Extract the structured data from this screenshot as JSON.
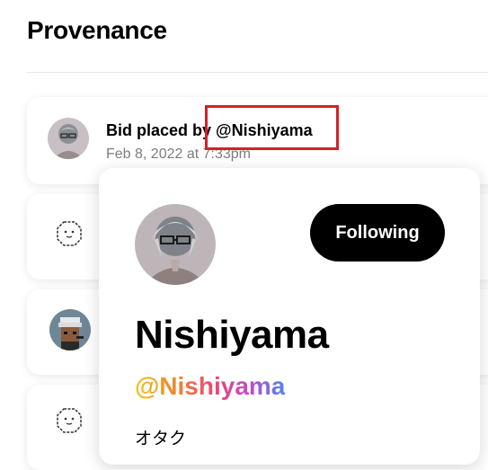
{
  "section": {
    "title": "Provenance"
  },
  "events": [
    {
      "text": "Bid placed by @Nishiyama",
      "date": "Feb 8, 2022 at 7:33pm"
    }
  ],
  "popover": {
    "follow_label": "Following",
    "name": "Nishiyama",
    "handle": "@Nishiyama",
    "bio": "オタク"
  },
  "colors": {
    "highlight": "#d5202a",
    "button_bg": "#000000",
    "secondary_text": "#7d7d7d"
  },
  "icons": [
    "avatar",
    "octagon-face-icon",
    "avatar-pixel"
  ]
}
